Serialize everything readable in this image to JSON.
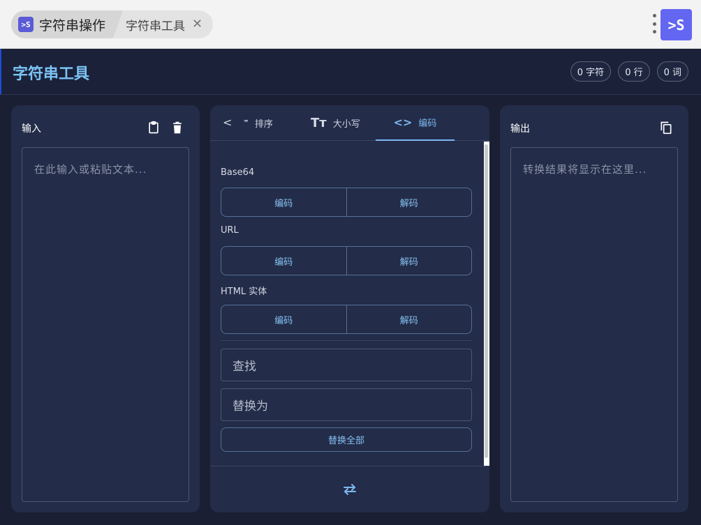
{
  "window": {
    "breadcrumb_root": "字符串操作",
    "breadcrumb_current": "字符串工具",
    "close_glyph": "✕",
    "app_badge": ">S",
    "logo": ">S"
  },
  "header": {
    "title": "字符串工具",
    "stats": {
      "chars": "0 字符",
      "lines": "0 行",
      "words": "0 词"
    }
  },
  "input_panel": {
    "title": "输入",
    "placeholder": "在此输入或粘贴文本..."
  },
  "output_panel": {
    "title": "输出",
    "placeholder": "转换结果将显示在这里..."
  },
  "tool_panel": {
    "tabs": [
      {
        "label": "排序",
        "icon": "sort-icon"
      },
      {
        "label": "大小写",
        "icon": "text-case-icon"
      },
      {
        "label": "编码",
        "icon": "code-icon",
        "active": true
      }
    ],
    "sections": [
      {
        "label": "Base64",
        "encode": "编码",
        "decode": "解码"
      },
      {
        "label": "URL",
        "encode": "编码",
        "decode": "解码"
      },
      {
        "label": "HTML 实体",
        "encode": "编码",
        "decode": "解码"
      }
    ],
    "find_placeholder": "查找",
    "replace_placeholder": "替换为",
    "replace_all": "替换全部"
  },
  "colors": {
    "accent": "#7cb8f0",
    "title": "#7cc4f5",
    "panel_bg": "#232c48",
    "app_bg": "#1b1f33"
  }
}
